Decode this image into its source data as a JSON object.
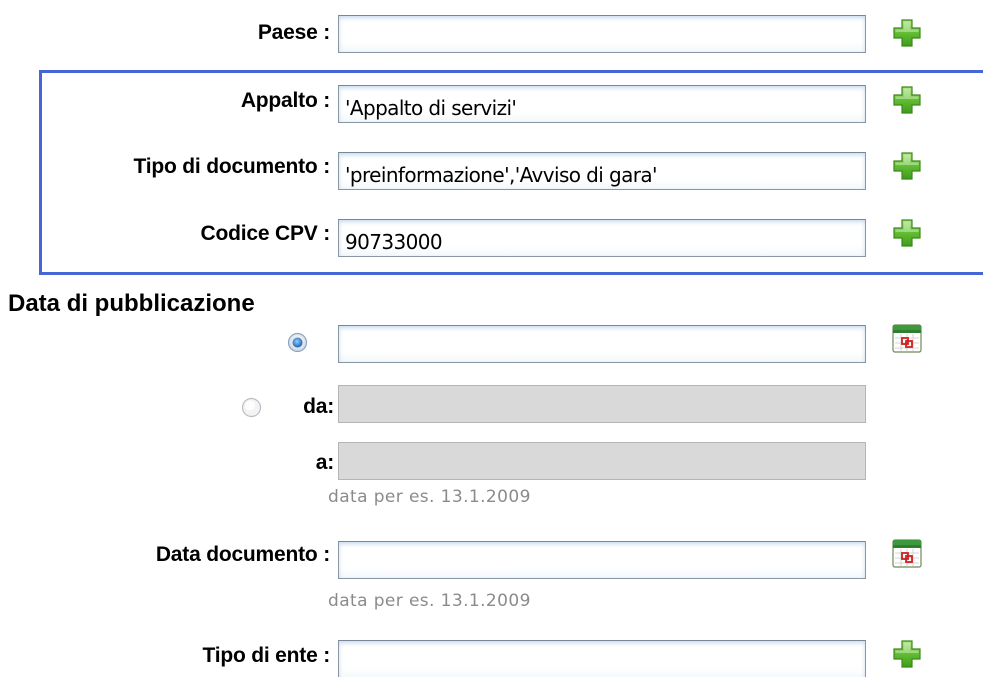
{
  "fields": {
    "paese": {
      "label": "Paese :",
      "value": ""
    },
    "appalto": {
      "label": "Appalto :",
      "value": "'Appalto di servizi'"
    },
    "tipo_documento": {
      "label": "Tipo di documento :",
      "value": "'preinformazione','Avviso di gara'"
    },
    "codice_cpv": {
      "label": "Codice CPV :",
      "value": "90733000"
    },
    "data_documento": {
      "label": "Data documento :",
      "value": ""
    },
    "tipo_ente": {
      "label": "Tipo di ente :",
      "value": ""
    }
  },
  "pubblicazione": {
    "title": "Data di pubblicazione",
    "single_value": "",
    "range_from_label": "da:",
    "range_to_label": "a:",
    "range_from_value": "",
    "range_to_value": "",
    "selected_option": "single"
  },
  "hints": {
    "pubblicazione": "data per es. 13.1.2009",
    "documento": "data per es. 13.1.2009"
  },
  "icons": {
    "add": "plus-icon",
    "calendar": "calendar-icon"
  },
  "colors": {
    "group_border": "#4466d6",
    "plus_green": "#5cb82e",
    "disabled_field": "#d9d9d9",
    "hint_text": "#8b8b8b"
  }
}
